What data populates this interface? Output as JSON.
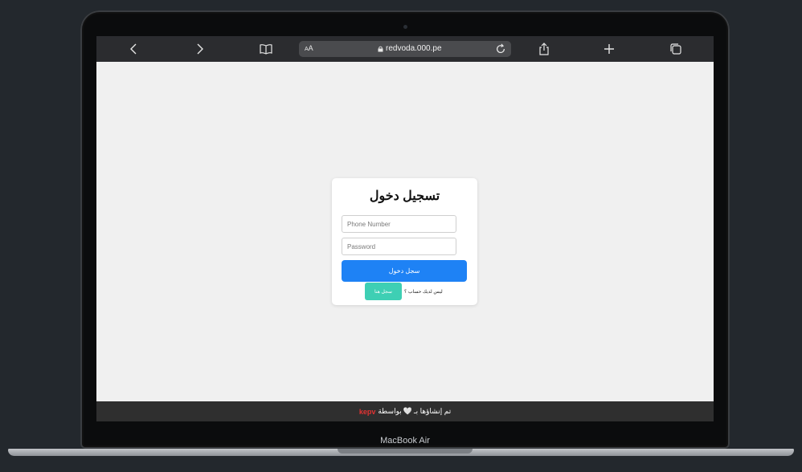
{
  "device": {
    "label": "MacBook Air"
  },
  "browser": {
    "text_size_label": "AA",
    "url": "redvoda.000.pe"
  },
  "login": {
    "title": "تسجيل دخول",
    "phone_placeholder": "Phone Number",
    "password_placeholder": "Password",
    "login_button": "سجل دخول",
    "no_account_text": "ليس لديك حساب ؟",
    "signup_button": "سجل هنا"
  },
  "footer": {
    "text": "تم إنشاؤها بـ",
    "by_text": "بواسطة",
    "brand": "kepv"
  },
  "colors": {
    "primary_button": "#1e82f5",
    "signup_button": "#3ecfb4",
    "brand": "#e23232"
  }
}
